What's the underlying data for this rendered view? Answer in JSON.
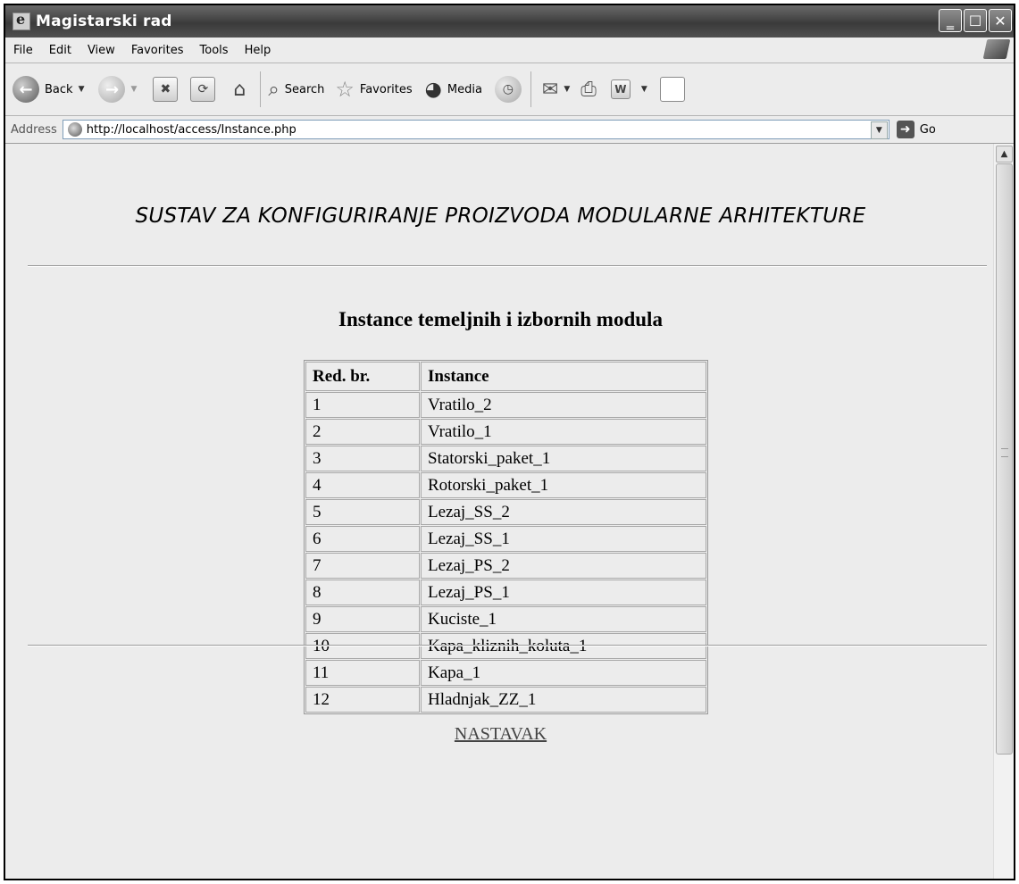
{
  "window": {
    "title": "Magistarski rad"
  },
  "menu": {
    "items": [
      "File",
      "Edit",
      "View",
      "Favorites",
      "Tools",
      "Help"
    ]
  },
  "toolbar": {
    "back_label": "Back",
    "search_label": "Search",
    "favorites_label": "Favorites",
    "media_label": "Media"
  },
  "address": {
    "label": "Address",
    "url": "http://localhost/access/Instance.php",
    "go_label": "Go"
  },
  "page": {
    "banner": "SUSTAV ZA KONFIGURIRANJE PROIZVODA MODULARNE ARHITEKTURE",
    "heading": "Instance temeljnih i izbornih  modula",
    "table": {
      "headers": [
        "Red. br.",
        "Instance"
      ],
      "rows": [
        [
          "1",
          "Vratilo_2"
        ],
        [
          "2",
          "Vratilo_1"
        ],
        [
          "3",
          "Statorski_paket_1"
        ],
        [
          "4",
          "Rotorski_paket_1"
        ],
        [
          "5",
          "Lezaj_SS_2"
        ],
        [
          "6",
          "Lezaj_SS_1"
        ],
        [
          "7",
          "Lezaj_PS_2"
        ],
        [
          "8",
          "Lezaj_PS_1"
        ],
        [
          "9",
          "Kuciste_1"
        ],
        [
          "10",
          "Kapa_kliznih_koluta_1"
        ],
        [
          "11",
          "Kapa_1"
        ],
        [
          "12",
          "Hladnjak_ZZ_1"
        ]
      ]
    },
    "link": "NASTAVAK"
  }
}
